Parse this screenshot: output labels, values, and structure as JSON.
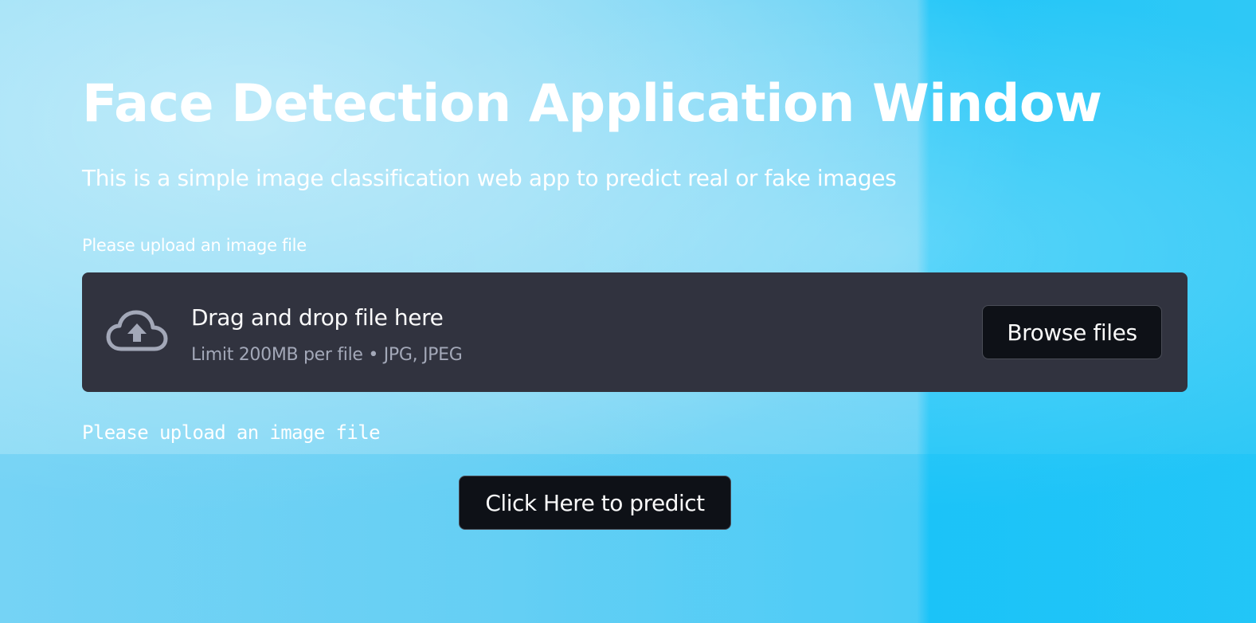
{
  "page": {
    "title": "Face Detection Application Window",
    "subtitle": "This is a simple image classification web app to predict real or fake images"
  },
  "uploader": {
    "label": "Please upload an image file",
    "dropzone_primary": "Drag and drop file here",
    "dropzone_secondary": "Limit 200MB per file • JPG, JPEG",
    "icon": "cloud-upload-icon",
    "browse_label": "Browse files"
  },
  "status": {
    "message": "Please upload an image file"
  },
  "actions": {
    "predict_label": "Click Here to predict"
  },
  "colors": {
    "background": "#4cc9f0",
    "dropzone": "#31333f",
    "button": "#0e1117",
    "text": "#ffffff",
    "muted_text": "#a3a8b8"
  }
}
